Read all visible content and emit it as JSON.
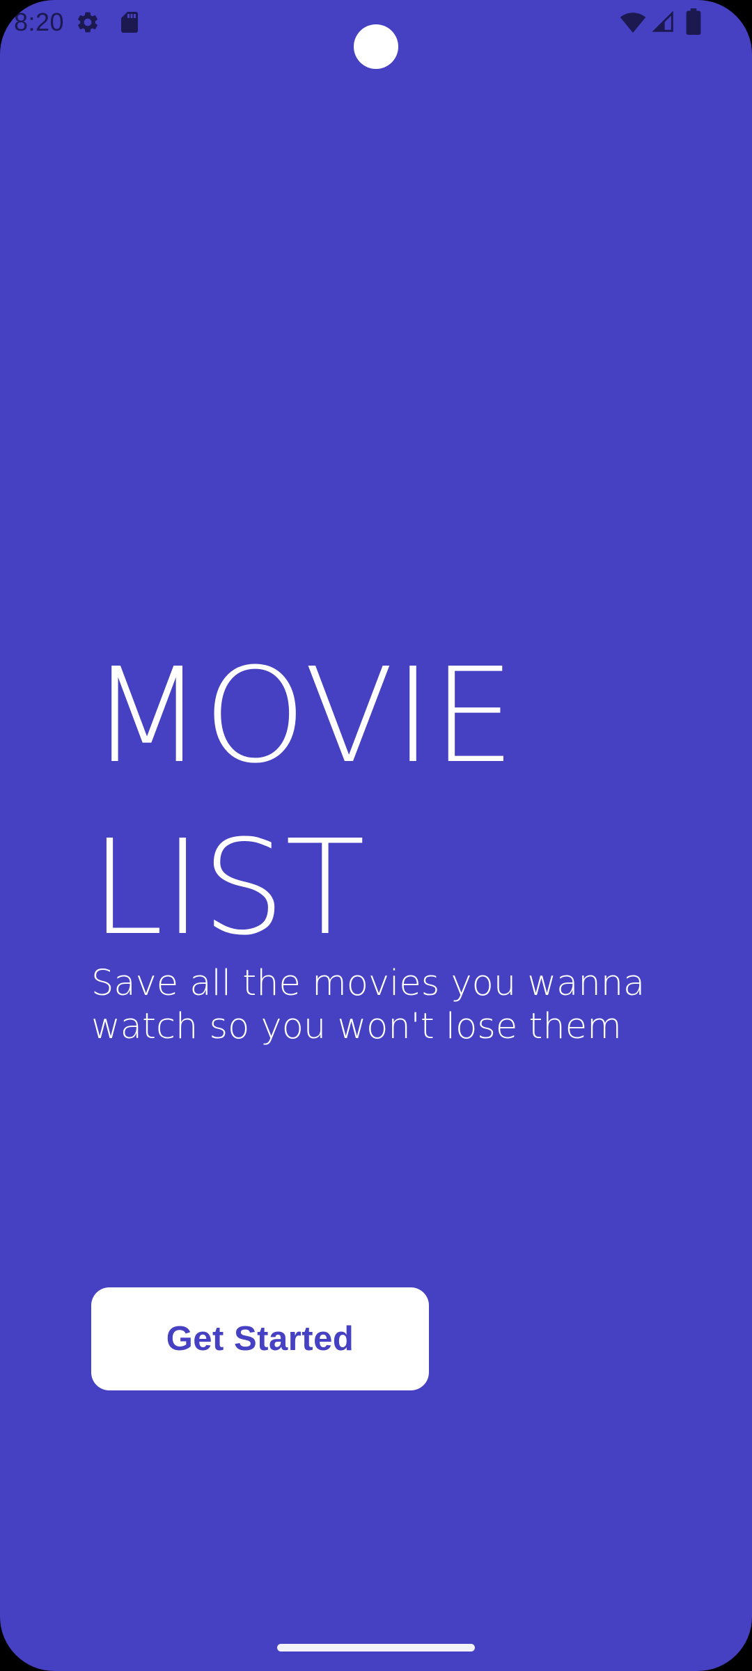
{
  "status_bar": {
    "time": "8:20",
    "icons": [
      "gear-icon",
      "sd-card-icon",
      "wifi-icon",
      "signal-icon",
      "battery-icon"
    ]
  },
  "main": {
    "title_line1": "MOVIE",
    "title_line2": "LIST",
    "subtitle": "Save all the movies you wanna watch so you won't lose them",
    "cta_label": "Get Started"
  },
  "colors": {
    "background": "#4640C3",
    "text": "#FFFFFF",
    "button_bg": "#FFFFFF",
    "button_text": "#4640C3",
    "status_icons": "#1B1950"
  }
}
